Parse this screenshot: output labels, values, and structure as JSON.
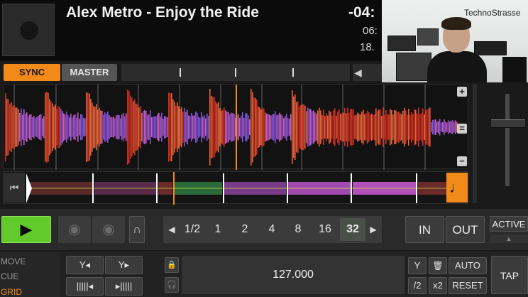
{
  "deck": {
    "track_title": "Alex Metro - Enjoy the Ride",
    "time_remaining": "-04:",
    "time_elapsed": "06:",
    "time_extra": "18.",
    "cover_icon": "vinyl-placeholder-icon"
  },
  "webcam": {
    "label": "TechnoStrasse"
  },
  "sync_bar": {
    "sync_label": "SYNC",
    "master_label": "MASTER",
    "right_glyph": "◀"
  },
  "waveform": {
    "zoom_in": "+",
    "zoom_mid": "=",
    "zoom_out": "−"
  },
  "overview": {
    "start_icon": "⏮",
    "note_icon": "♩"
  },
  "transport": {
    "play_glyph": "▶",
    "cue_glyph": "◉",
    "scratch_glyph": "◉",
    "flux_glyph": "∩",
    "loop_prev": "◀",
    "loop_next": "▶",
    "loop_sizes": [
      "1/2",
      "1",
      "2",
      "4",
      "8",
      "16",
      "32"
    ],
    "loop_active": "32",
    "in_label": "IN",
    "out_label": "OUT",
    "active_label": "ACTIVE",
    "active_arrow": "▲"
  },
  "bottom": {
    "modes": [
      "MOVE",
      "CUE",
      "GRID"
    ],
    "active_mode": "GRID",
    "lock_icon": "🔒",
    "headphone_icon": "🎧",
    "bpm": "127.000",
    "grid_marker_icon": "Y",
    "delete_icon": "🗑",
    "auto_label": "AUTO",
    "half_label": "/2",
    "double_label": "x2",
    "reset_label": "RESET",
    "tap_label": "TAP"
  },
  "colors": {
    "accent_orange": "#f28a1a",
    "play_green": "#63ca2c",
    "wave_purple": "#8f5bf0",
    "wave_red": "#e43322",
    "wave_magenta": "#d864d8"
  }
}
